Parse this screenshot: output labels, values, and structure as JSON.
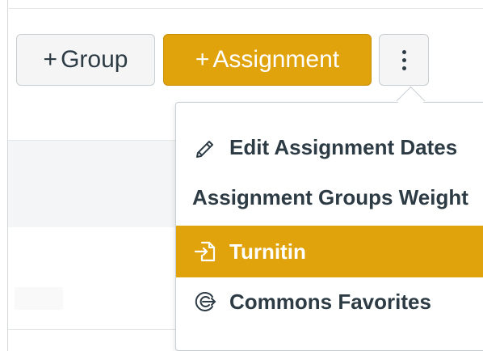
{
  "toolbar": {
    "group_plus": "+",
    "group_label": "Group",
    "assignment_plus": "+",
    "assignment_label": "Assignment",
    "more_icon": "kebab-vertical-icon"
  },
  "menu": {
    "items": [
      {
        "icon": "pencil-icon",
        "label": "Edit Assignment Dates"
      },
      {
        "icon": "",
        "label": "Assignment Groups Weight"
      },
      {
        "icon": "external-tool-icon",
        "label": "Turnitin"
      },
      {
        "icon": "commons-icon",
        "label": "Commons Favorites"
      }
    ]
  },
  "colors": {
    "accent": "#e0a30c",
    "text": "#2d3b45",
    "secondary_button_bg": "#f5f5f5",
    "border": "#c7cdd1"
  }
}
